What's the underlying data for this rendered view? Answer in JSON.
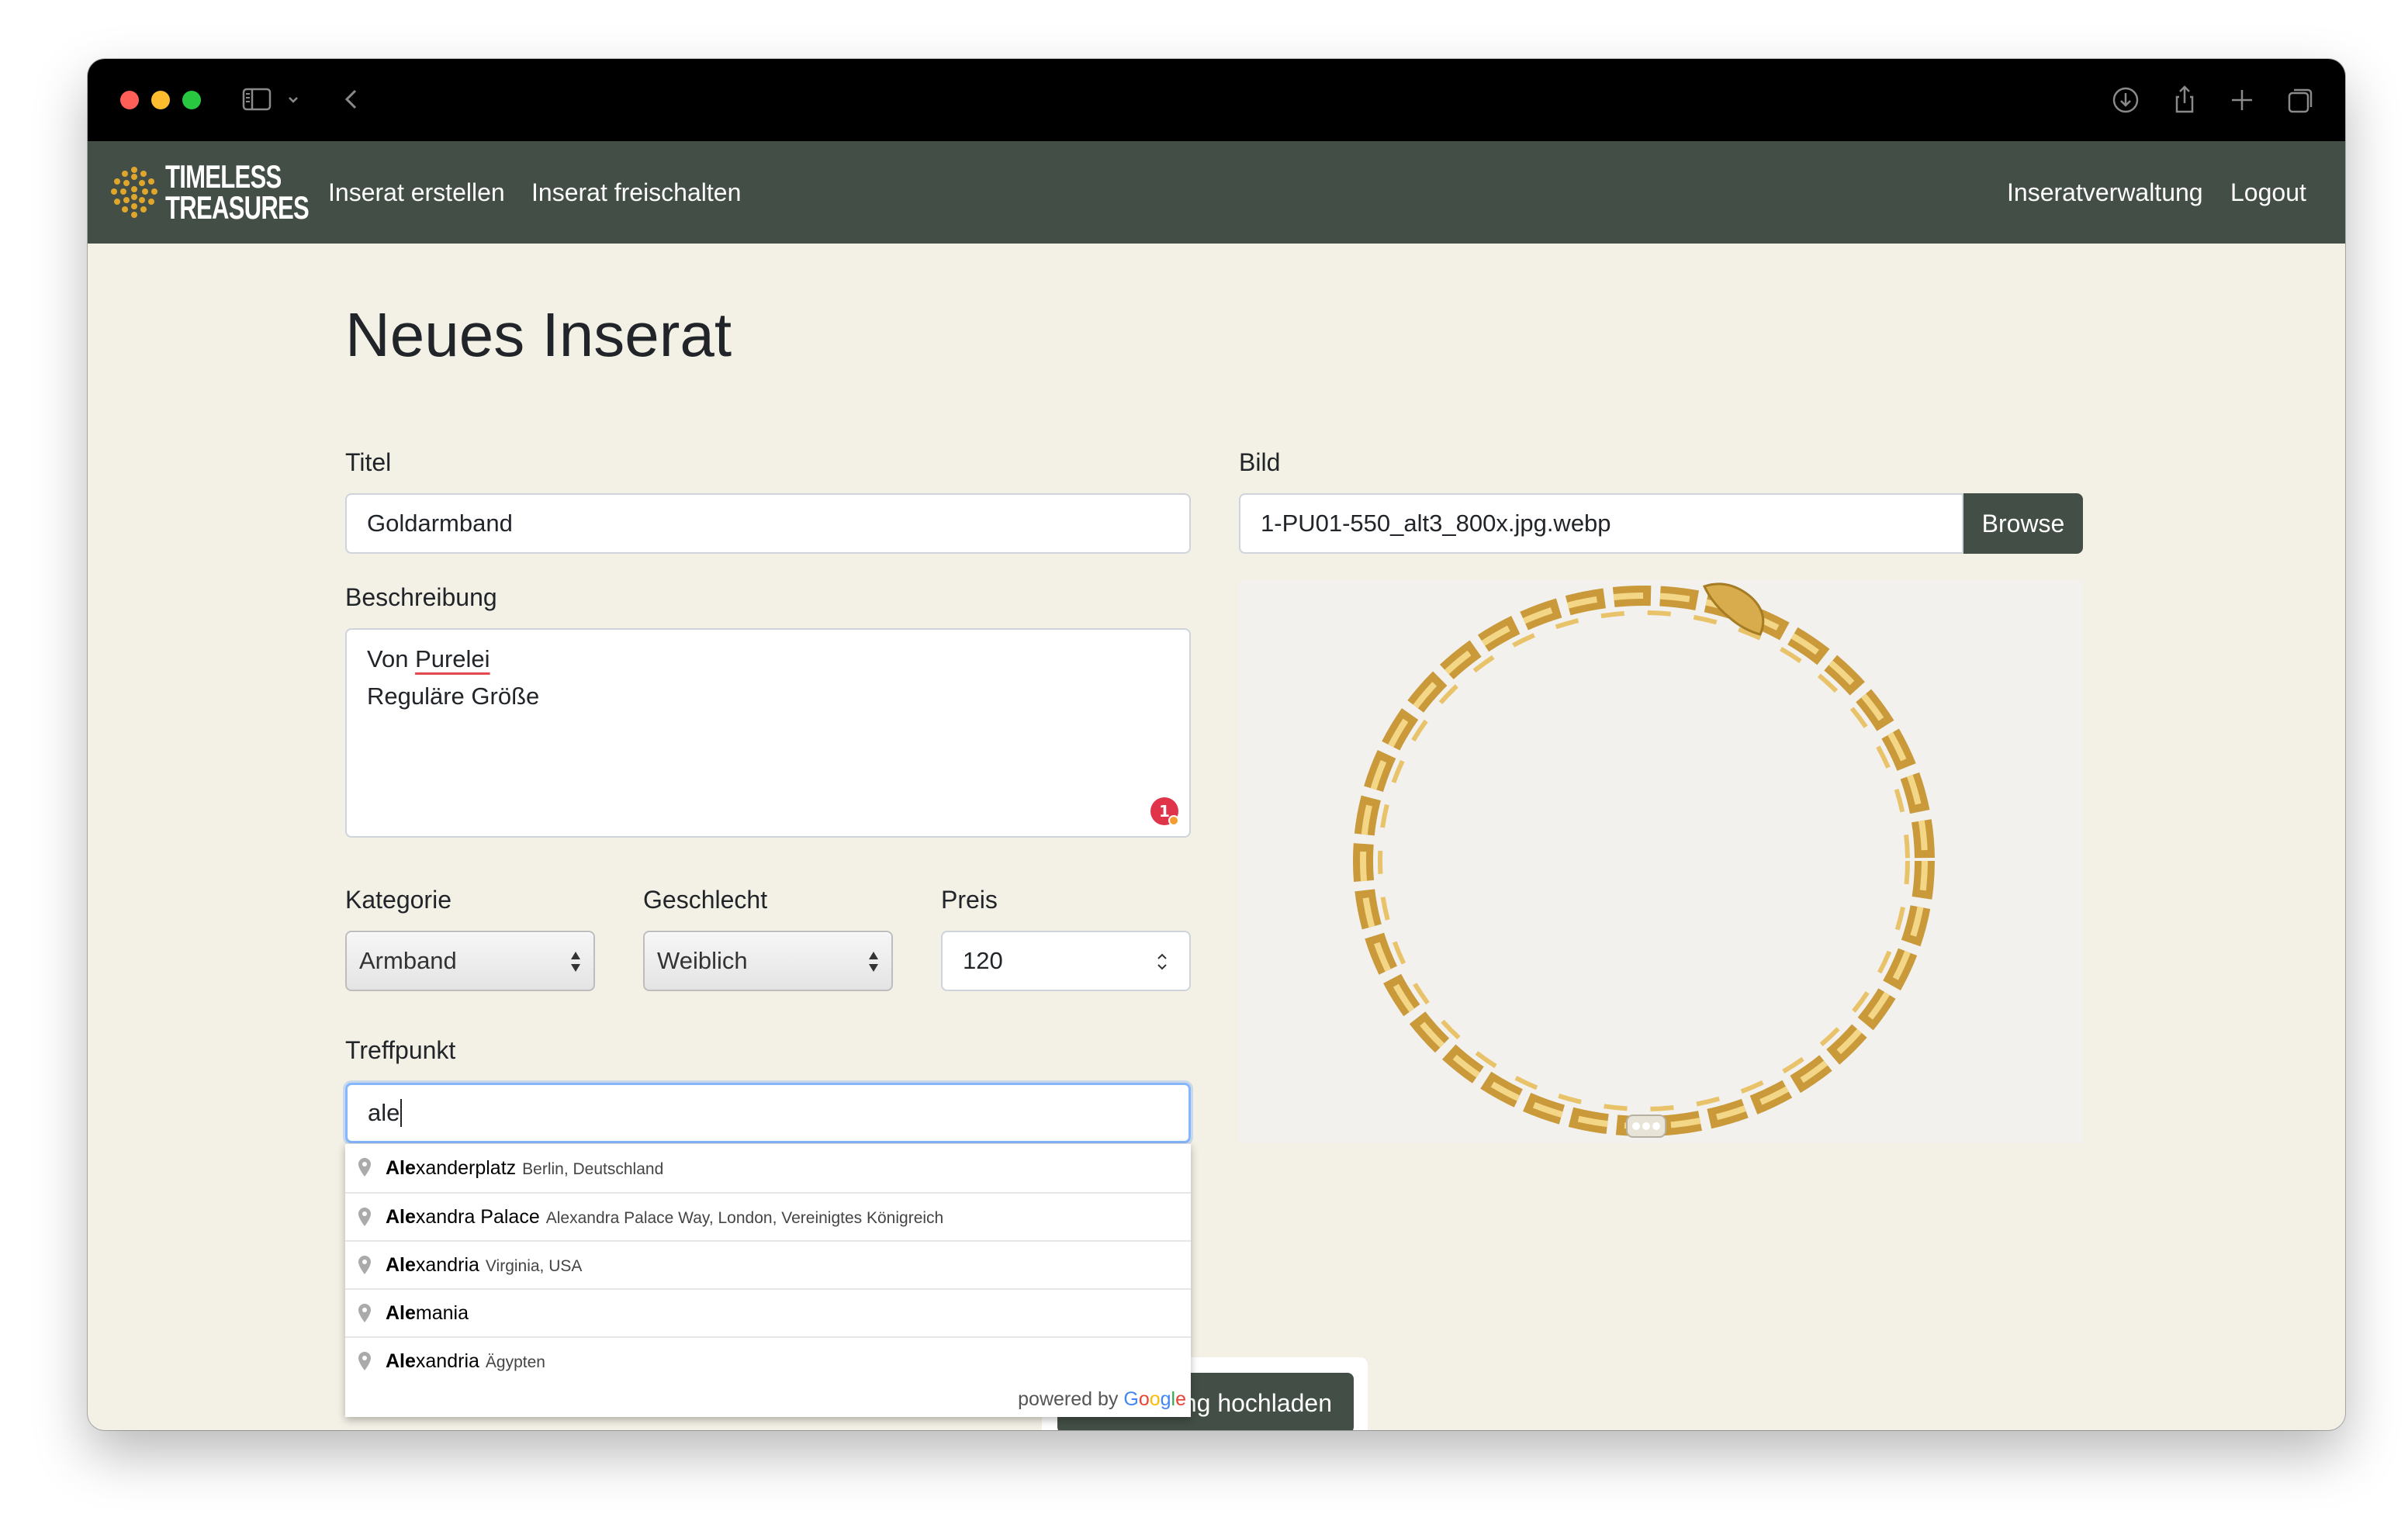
{
  "browser": {
    "traffic_lights": [
      "#ff5f57",
      "#febc2e",
      "#28c840"
    ]
  },
  "nav": {
    "logo_line1": "TIMELESS",
    "logo_line2": "TREASURES",
    "create": "Inserat erstellen",
    "unlock": "Inserat freischalten",
    "manage": "Inseratverwaltung",
    "logout": "Logout"
  },
  "form": {
    "page_title": "Neues Inserat",
    "title_label": "Titel",
    "title_value": "Goldarmband",
    "description_label": "Beschreibung",
    "description_line1_prefix": "Von ",
    "description_line1_word": "Purelei",
    "description_line2": "Reguläre Größe",
    "grammar_issue_count": "1",
    "category_label": "Kategorie",
    "category_value": "Armband",
    "gender_label": "Geschlecht",
    "gender_value": "Weiblich",
    "price_label": "Preis",
    "price_value": "120",
    "meeting_label": "Treffpunkt",
    "meeting_value": "ale",
    "image_label": "Bild",
    "image_filename": "1-PU01-550_alt3_800x.jpg.webp",
    "browse_label": "Browse",
    "upload_label": "ng hochladen"
  },
  "autocomplete": {
    "items": [
      {
        "match": "Ale",
        "rest": "xanderplatz",
        "secondary": "Berlin, Deutschland"
      },
      {
        "match": "Ale",
        "rest": "xandra Palace",
        "secondary": "Alexandra Palace Way, London, Vereinigtes Königreich"
      },
      {
        "match": "Ale",
        "rest": "xandria",
        "secondary": "Virginia, USA"
      },
      {
        "match": "Ale",
        "rest": "mania",
        "secondary": ""
      },
      {
        "match": "Ale",
        "rest": "xandria",
        "secondary": "Ägypten"
      }
    ],
    "powered_by": "powered by",
    "google": [
      "G",
      "o",
      "o",
      "g",
      "l",
      "e"
    ]
  },
  "colors": {
    "nav_bg": "#434f46",
    "page_bg": "#f3f1e6",
    "accent_gold": "#e0a62b",
    "focus": "#86b7fe"
  }
}
